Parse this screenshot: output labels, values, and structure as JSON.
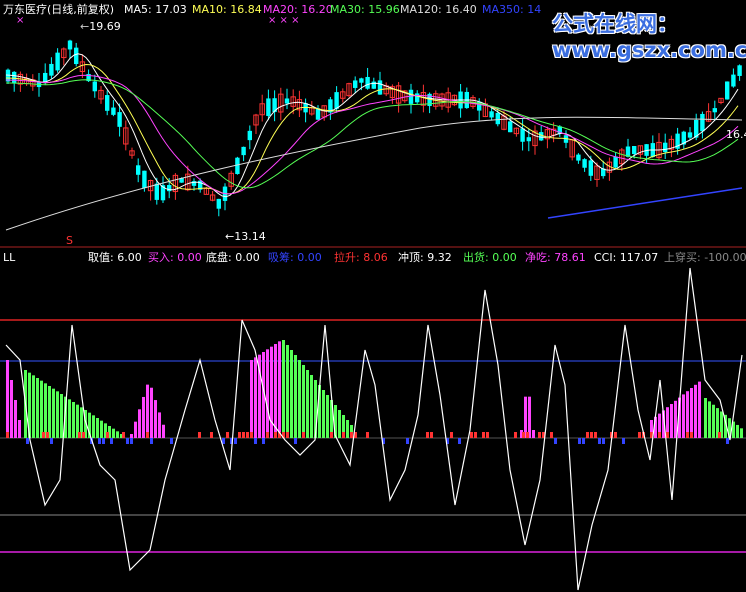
{
  "header": {
    "title": "万东医疗(日线,前复权)",
    "ma": [
      {
        "label": "MA5:",
        "value": "17.03",
        "color": "#ffffff"
      },
      {
        "label": "MA10:",
        "value": "16.84",
        "color": "#ffff55"
      },
      {
        "label": "MA20:",
        "value": "16.20",
        "color": "#ff44ff"
      },
      {
        "label": "MA30:",
        "value": "15.96",
        "color": "#55ff55"
      },
      {
        "label": "MA120:",
        "value": "16.40",
        "color": "#dddddd"
      },
      {
        "label": "MA350:",
        "value": "14",
        "color": "#3344ff"
      }
    ]
  },
  "watermark": "公式在线网：www.gszx.com.cn",
  "price_panel": {
    "high_label": "19.69",
    "low_label": "13.14",
    "right_label": "16.4",
    "marker_x": "×",
    "marker_xxx": "× × ×",
    "marker_s": "S"
  },
  "indicator_panel": {
    "name": "LL",
    "readouts": [
      {
        "label": "取值:",
        "value": "6.00",
        "color": "#ffffff"
      },
      {
        "label": "买入:",
        "value": "0.00",
        "color": "#ff44ff"
      },
      {
        "label": "底盘:",
        "value": "0.00",
        "color": "#ffffff"
      },
      {
        "label": "吸筹:",
        "value": "0.00",
        "color": "#3344ff"
      },
      {
        "label": "拉升:",
        "value": "8.06",
        "color": "#ff3333"
      },
      {
        "label": "冲顶:",
        "value": "9.32",
        "color": "#ffffff"
      },
      {
        "label": "出货:",
        "value": "0.00",
        "color": "#55ff55"
      },
      {
        "label": "净吃:",
        "value": "78.61",
        "color": "#ff44ff"
      },
      {
        "label": "CCI:",
        "value": "117.07",
        "color": "#ffffff"
      },
      {
        "label": "上穿买:",
        "value": "-100.00",
        "color": "#888888"
      }
    ]
  },
  "colors": {
    "up": "#ff3333",
    "down": "#00ffff",
    "ma5": "#ffffff",
    "ma10": "#ffff55",
    "ma20": "#ff44ff",
    "ma30": "#55ff55",
    "ma120": "#dddddd",
    "ma350": "#3344ff",
    "upper_line": "#dd2222",
    "mid_line": "#3355ff",
    "low_line": "#888888",
    "bottom_line": "#dd22dd"
  }
}
